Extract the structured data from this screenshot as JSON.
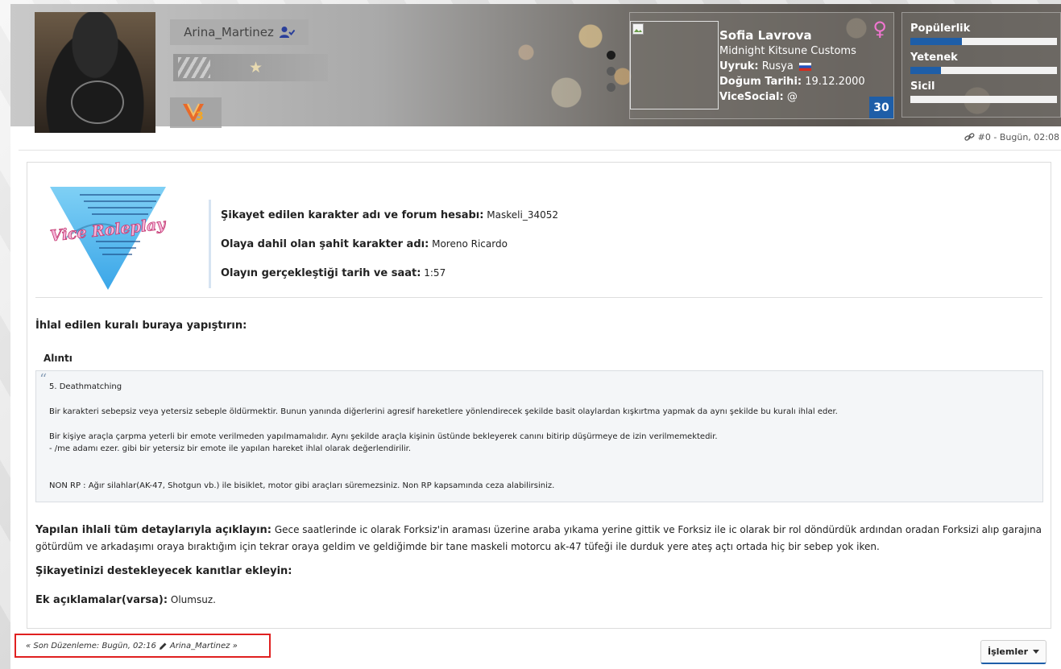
{
  "profile": {
    "username": "Arina_Martinez",
    "icons": {
      "verify": "user-check-icon",
      "star": "star-icon",
      "level_badge": "v-level-icon"
    },
    "level": "3"
  },
  "character": {
    "name": "Sofia Lavrova",
    "company": "Midnight Kitsune Customs",
    "nationality_label": "Uyruk:",
    "nationality": "Rusya",
    "birth_label": "Doğum Tarihi:",
    "birth_date": "19.12.2000",
    "social_label": "ViceSocial:",
    "social": "@",
    "age": "30",
    "gender_icon": "female-icon",
    "colors": {
      "accent": "#1e5ea8",
      "female": "#f076d0"
    }
  },
  "stats": [
    {
      "label": "Popülerlik",
      "fraction": 0.35
    },
    {
      "label": "Yetenek",
      "fraction": 0.21
    },
    {
      "label": "Sicil",
      "fraction": 0
    }
  ],
  "post_meta": {
    "text": "#0 - Bugün, 02:08"
  },
  "logo_text": "Vice Roleplay",
  "form": {
    "accused_label": "Şikayet edilen karakter adı ve forum hesabı:",
    "accused_value": "Maskeli_34052",
    "witness_label": "Olaya dahil olan şahit karakter adı:",
    "witness_value": "Moreno Ricardo",
    "datetime_label": "Olayın gerçekleştiği tarih ve saat:",
    "datetime_value": "1:57",
    "rule_heading": "İhlal edilen kuralı buraya yapıştırın:",
    "quote_title": "Alıntı",
    "quote_lines": [
      "5. Deathmatching",
      "Bir karakteri sebepsiz veya yetersiz sebeple öldürmektir. Bunun yanında diğerlerini agresif hareketlere yönlendirecek şekilde basit olaylardan kışkırtma yapmak da aynı şekilde bu kuralı ihlal eder.",
      "Bir kişiye araçla çarpma yeterli bir emote verilmeden yapılmamalıdır. Aynı şekilde araçla kişinin üstünde bekleyerek canını bitirip düşürmeye de izin verilmemektedir.",
      "- /me adamı ezer.  gibi bir yetersiz bir emote ile yapılan hareket ihlal olarak değerlendirilir.",
      "NON RP : Ağır silahlar(AK-47, Shotgun vb.) ile bisiklet, motor gibi araçları süremezsiniz. Non RP kapsamında ceza alabilirsiniz."
    ],
    "detail_label": "Yapılan ihlali tüm detaylarıyla açıklayın:",
    "detail_value": "Gece saatlerinde ic olarak Forksiz'in araması üzerine araba yıkama yerine gittik ve Forksiz ile ic olarak bir rol döndürdük ardından oradan Forksizi alıp garajına götürdüm ve arkadaşımı oraya bıraktığım için tekrar oraya geldim ve geldiğimde bir tane maskeli motorcu ak-47 tüfeği ile durduk yere ateş açtı ortada hiç bir sebep yok iken.",
    "evidence_label": "Şikayetinizi destekleyecek kanıtlar ekleyin:",
    "extra_label": "Ek açıklamalar(varsa):",
    "extra_value": "Olumsuz."
  },
  "footer": {
    "last_edit_prefix": "« Son Düzenleme: Bugün, 02:16",
    "last_edit_user": "Arina_Martinez »",
    "actions_label": "İşlemler"
  }
}
